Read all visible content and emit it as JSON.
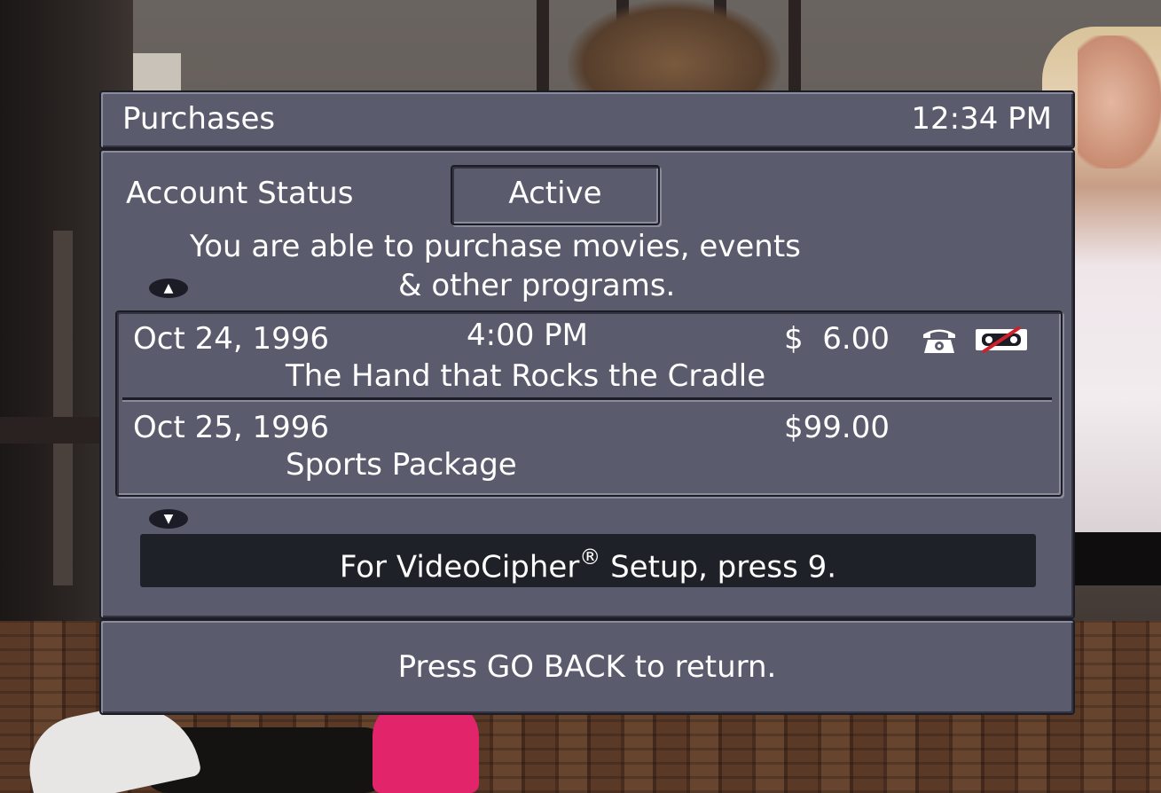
{
  "header": {
    "title": "Purchases",
    "time": "12:34 PM"
  },
  "account": {
    "label": "Account Status",
    "status": "Active",
    "message_line1": "You are able to purchase movies, events",
    "message_line2": "& other programs."
  },
  "purchases": [
    {
      "date": "Oct 24, 1996",
      "time": "4:00 PM",
      "price": "$  6.00",
      "title": "The Hand that Rocks the Cradle",
      "icons": [
        "phone-icon",
        "no-tape-icon"
      ]
    },
    {
      "date": "Oct 25, 1996",
      "time": "",
      "price": "$99.00",
      "title": "Sports Package",
      "icons": []
    }
  ],
  "videocipher": {
    "text_before": "For VideoCipher",
    "mark": "®",
    "text_after": " Setup, press 9."
  },
  "footer": {
    "text": "Press GO BACK to return."
  },
  "colors": {
    "panel": "#5a5b6c",
    "panel_border": "#1c1c26",
    "bar": "#1f2128",
    "text": "#ffffff",
    "tape_slash": "#d0202a"
  }
}
